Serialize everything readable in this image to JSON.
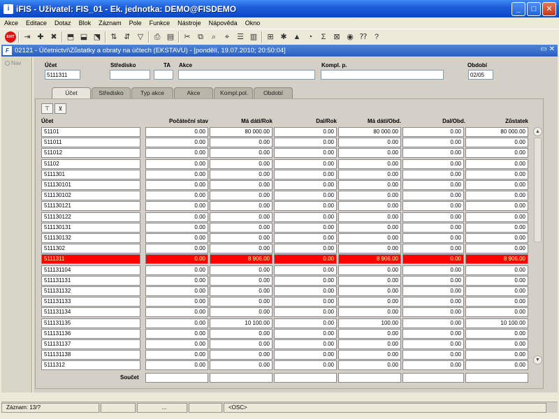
{
  "window": {
    "title": "iFIS - Uživatel: FIS_01 - Ek. jednotka: DEMO@FISDEMO"
  },
  "menu": [
    "Akce",
    "Editace",
    "Dotaz",
    "Blok",
    "Záznam",
    "Pole",
    "Funkce",
    "Nástroje",
    "Nápověda",
    "Okno"
  ],
  "toolbar": {
    "exit_label": "EXIT"
  },
  "form": {
    "title": "02121 - Účetnictví\\Zůstatky a obraty na účtech (EKSTAVU) - [pondělí, 19.07.2010; 20:50:04]"
  },
  "nav_label": "Nav",
  "header": {
    "ucet_label": "Účet",
    "ucet_value": "5111311",
    "stredisko_label": "Středisko",
    "stredisko_value": "",
    "ta_label": "TA",
    "ta_value": "",
    "akce_label": "Akce",
    "akce_value": "",
    "kompl_label": "Kompl. p.",
    "kompl_value": "",
    "obdobi_label": "Období",
    "obdobi_value": "02/05"
  },
  "tabs": [
    "Účet",
    "Středisko",
    "Typ akce",
    "Akce",
    "Kompl.pol.",
    "Období"
  ],
  "columns": [
    "Účet",
    "Počáteční stav",
    "Má dáti/Rok",
    "Dal/Rok",
    "Má dáti/Obd.",
    "Dal/Obd.",
    "Zůstatek"
  ],
  "rows": [
    [
      "51101",
      "0.00",
      "80 000.00",
      "0.00",
      "80 000.00",
      "0.00",
      "80 000.00"
    ],
    [
      "511011",
      "0.00",
      "0.00",
      "0.00",
      "0.00",
      "0.00",
      "0.00"
    ],
    [
      "511012",
      "0.00",
      "0.00",
      "0.00",
      "0.00",
      "0.00",
      "0.00"
    ],
    [
      "51102",
      "0.00",
      "0.00",
      "0.00",
      "0.00",
      "0.00",
      "0.00"
    ],
    [
      "5111301",
      "0.00",
      "0.00",
      "0.00",
      "0.00",
      "0.00",
      "0.00"
    ],
    [
      "511130101",
      "0.00",
      "0.00",
      "0.00",
      "0.00",
      "0.00",
      "0.00"
    ],
    [
      "511130102",
      "0.00",
      "0.00",
      "0.00",
      "0.00",
      "0.00",
      "0.00"
    ],
    [
      "511130121",
      "0.00",
      "0.00",
      "0.00",
      "0.00",
      "0.00",
      "0.00"
    ],
    [
      "511130122",
      "0.00",
      "0.00",
      "0.00",
      "0.00",
      "0.00",
      "0.00"
    ],
    [
      "511130131",
      "0.00",
      "0.00",
      "0.00",
      "0.00",
      "0.00",
      "0.00"
    ],
    [
      "511130132",
      "0.00",
      "0.00",
      "0.00",
      "0.00",
      "0.00",
      "0.00"
    ],
    [
      "5111302",
      "0.00",
      "0.00",
      "0.00",
      "0.00",
      "0.00",
      "0.00"
    ],
    [
      "5111311",
      "0.00",
      "8 906.00",
      "0.00",
      "8 906.00",
      "0.00",
      "8 906.00"
    ],
    [
      "511131104",
      "0.00",
      "0.00",
      "0.00",
      "0.00",
      "0.00",
      "0.00"
    ],
    [
      "511131131",
      "0.00",
      "0.00",
      "0.00",
      "0.00",
      "0.00",
      "0.00"
    ],
    [
      "511131132",
      "0.00",
      "0.00",
      "0.00",
      "0.00",
      "0.00",
      "0.00"
    ],
    [
      "511131133",
      "0.00",
      "0.00",
      "0.00",
      "0.00",
      "0.00",
      "0.00"
    ],
    [
      "511131134",
      "0.00",
      "0.00",
      "0.00",
      "0.00",
      "0.00",
      "0.00"
    ],
    [
      "511131135",
      "0.00",
      "10 100.00",
      "0.00",
      "100.00",
      "0.00",
      "10 100.00"
    ],
    [
      "511131136",
      "0.00",
      "0.00",
      "0.00",
      "0.00",
      "0.00",
      "0.00"
    ],
    [
      "511131137",
      "0.00",
      "0.00",
      "0.00",
      "0.00",
      "0.00",
      "0.00"
    ],
    [
      "511131138",
      "0.00",
      "0.00",
      "0.00",
      "0.00",
      "0.00",
      "0.00"
    ],
    [
      "5111312",
      "0.00",
      "0.00",
      "0.00",
      "0.00",
      "0.00",
      "0.00"
    ]
  ],
  "selected_row": 12,
  "sum_label": "Součet",
  "status": {
    "record": "Záznam: 13/?",
    "ellipsis": "...",
    "osc": "<OSC>"
  }
}
